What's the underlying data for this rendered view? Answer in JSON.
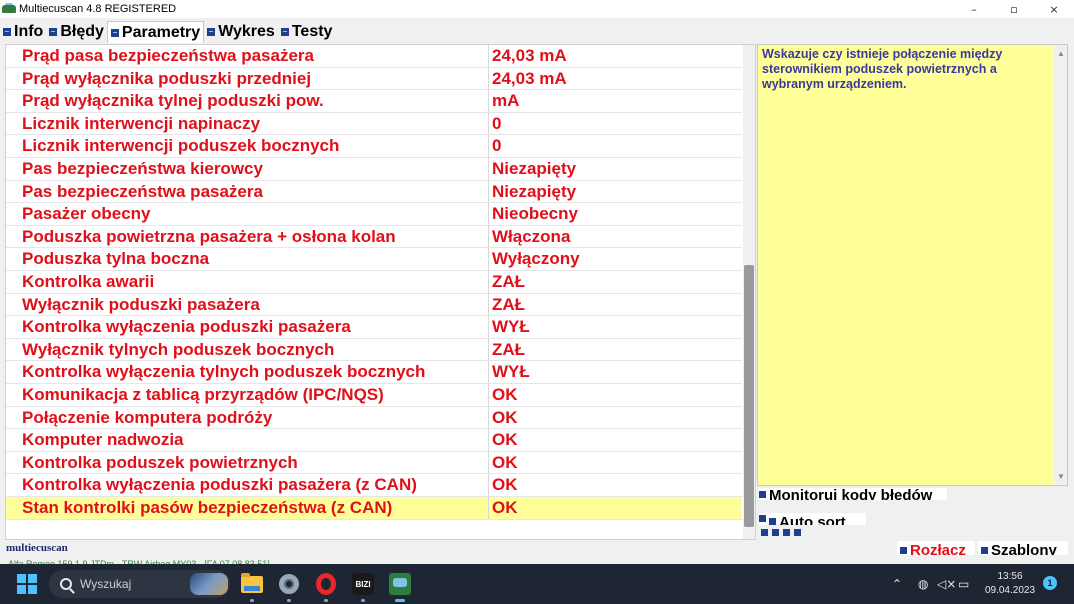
{
  "window": {
    "title": "Multiecuscan 4.8 REGISTERED",
    "minimize": "–",
    "maximize": "▫",
    "close": "×"
  },
  "tabs": [
    {
      "label": "Info"
    },
    {
      "label": "Błędy"
    },
    {
      "label": "Parametry"
    },
    {
      "label": "Wykres"
    },
    {
      "label": "Testy"
    }
  ],
  "parameters": [
    {
      "name": "Prąd pasa bezpieczeństwa pasażera",
      "value": "24,03 mA"
    },
    {
      "name": "Prąd wyłącznika poduszki przedniej",
      "value": "24,03 mA"
    },
    {
      "name": "Prąd wyłącznika tylnej poduszki pow.",
      "value": " mA"
    },
    {
      "name": "Licznik interwencji napinaczy",
      "value": "0"
    },
    {
      "name": "Licznik interwencji poduszek bocznych",
      "value": "0"
    },
    {
      "name": "Pas bezpieczeństwa kierowcy",
      "value": "Niezapięty"
    },
    {
      "name": "Pas bezpieczeństwa pasażera",
      "value": "Niezapięty"
    },
    {
      "name": "Pasażer obecny",
      "value": "Nieobecny"
    },
    {
      "name": "Poduszka powietrzna pasażera + osłona kolan",
      "value": "Włączona"
    },
    {
      "name": "Poduszka tylna boczna",
      "value": "Wyłączony"
    },
    {
      "name": "Kontrolka awarii",
      "value": "ZAŁ"
    },
    {
      "name": "Wyłącznik poduszki pasażera",
      "value": "ZAŁ"
    },
    {
      "name": "Kontrolka wyłączenia poduszki pasażera",
      "value": "WYŁ"
    },
    {
      "name": "Wyłącznik tylnych poduszek bocznych",
      "value": "ZAŁ"
    },
    {
      "name": "Kontrolka wyłączenia tylnych poduszek bocznych",
      "value": "WYŁ"
    },
    {
      "name": "Komunikacja z tablicą przyrządów (IPC/NQS)",
      "value": "OK"
    },
    {
      "name": "Połączenie komputera podróży",
      "value": "OK"
    },
    {
      "name": "Komputer nadwozia",
      "value": "OK"
    },
    {
      "name": "Kontrolka poduszek powietrznych",
      "value": "OK"
    },
    {
      "name": "Kontrolka wyłączenia poduszki pasażera (z CAN)",
      "value": "OK"
    },
    {
      "name": "Stan kontrolki pasów bezpieczeństwa (z CAN)",
      "value": "OK"
    }
  ],
  "description": "Wskazuje czy istnieje połączenie między sterownikiem poduszek powietrznych a wybranym urządzeniem.",
  "options": {
    "monitor_label": "Monitoruj kody błędów",
    "autosort_label": "Auto sort"
  },
  "buttons": {
    "disconnect": "Rozłącz",
    "templates": "Szablony"
  },
  "footer": {
    "brand": "multiecuscan",
    "status": "Alfa Romeo 159 1.9 JTDm - TRW Airbag MY03 - [FA 07 08 83 51]"
  },
  "taskbar": {
    "search_placeholder": "Wyszukaj",
    "bizi_label": "BIZI",
    "time": "13:56",
    "date": "09.04.2023",
    "notifications": "1"
  },
  "colors": {
    "param_text": "#e0101a",
    "selected_row": "#ffff99",
    "description_bg": "#ffff99",
    "description_text": "#3a3a9a",
    "taskbar_bg": "#1f2633"
  }
}
